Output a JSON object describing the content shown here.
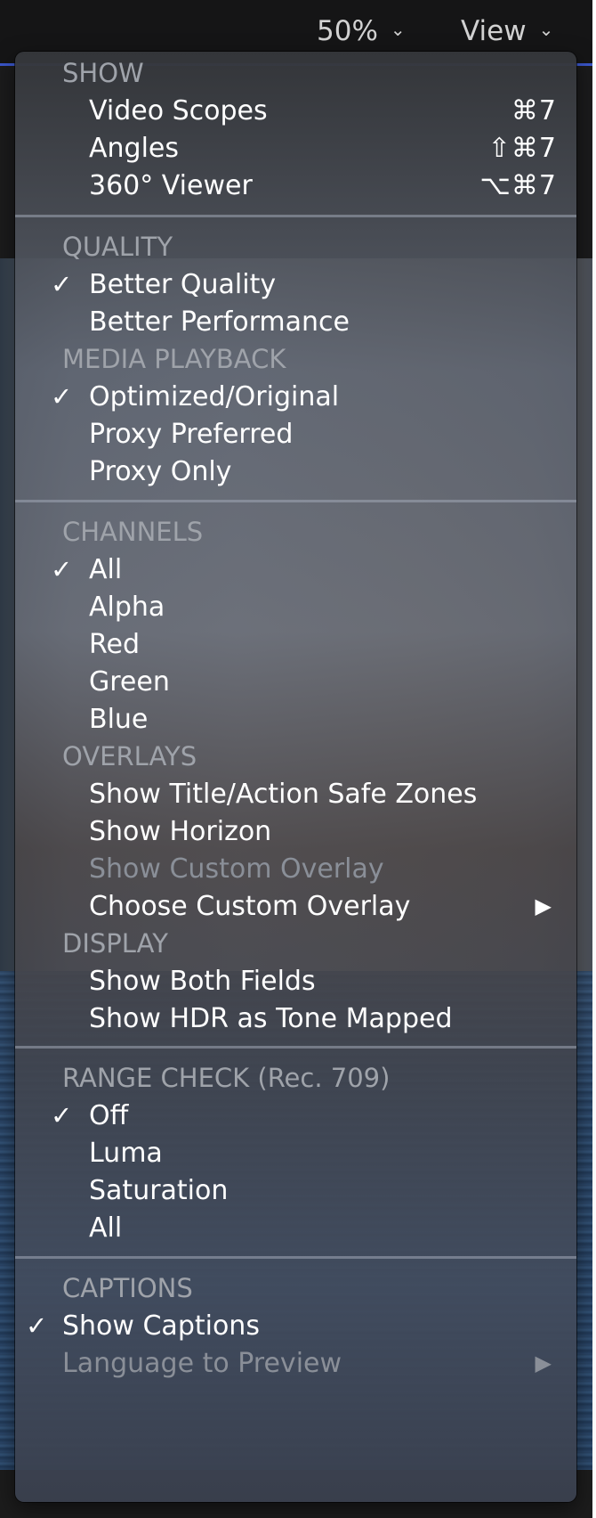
{
  "toolbar": {
    "zoom_label": "50%",
    "view_label": "View"
  },
  "menu": {
    "show_header": "SHOW",
    "video_scopes": "Video Scopes",
    "video_scopes_shortcut": "⌘7",
    "angles": "Angles",
    "angles_shortcut": "⇧⌘7",
    "viewer_360": "360° Viewer",
    "viewer_360_shortcut": "⌥⌘7",
    "quality_header": "QUALITY",
    "better_quality": "Better Quality",
    "better_performance": "Better Performance",
    "media_playback_header": "MEDIA PLAYBACK",
    "optimized_original": "Optimized/Original",
    "proxy_preferred": "Proxy Preferred",
    "proxy_only": "Proxy Only",
    "channels_header": "CHANNELS",
    "channel_all": "All",
    "channel_alpha": "Alpha",
    "channel_red": "Red",
    "channel_green": "Green",
    "channel_blue": "Blue",
    "overlays_header": "OVERLAYS",
    "title_action_safe": "Show Title/Action Safe Zones",
    "show_horizon": "Show Horizon",
    "show_custom_overlay": "Show Custom Overlay",
    "choose_custom_overlay": "Choose Custom Overlay",
    "display_header": "DISPLAY",
    "show_both_fields": "Show Both Fields",
    "show_hdr_tone_mapped": "Show HDR as Tone Mapped",
    "range_check_header": "RANGE CHECK (Rec. 709)",
    "range_off": "Off",
    "range_luma": "Luma",
    "range_saturation": "Saturation",
    "range_all": "All",
    "captions_header": "CAPTIONS",
    "show_captions": "Show Captions",
    "language_to_preview": "Language to Preview"
  },
  "glyphs": {
    "check": "✓",
    "submenu_arrow": "▶",
    "chevron": "⌄"
  },
  "checked_items": [
    "Better Quality",
    "Optimized/Original",
    "All",
    "Off",
    "Show Captions"
  ],
  "disabled_items": [
    "Show Custom Overlay",
    "Language to Preview"
  ],
  "colors": {
    "menu_text": "#ffffff",
    "section_header": "#9fa3aa",
    "disabled_text": "#8a8f98",
    "accent_line": "#3a56c9"
  }
}
